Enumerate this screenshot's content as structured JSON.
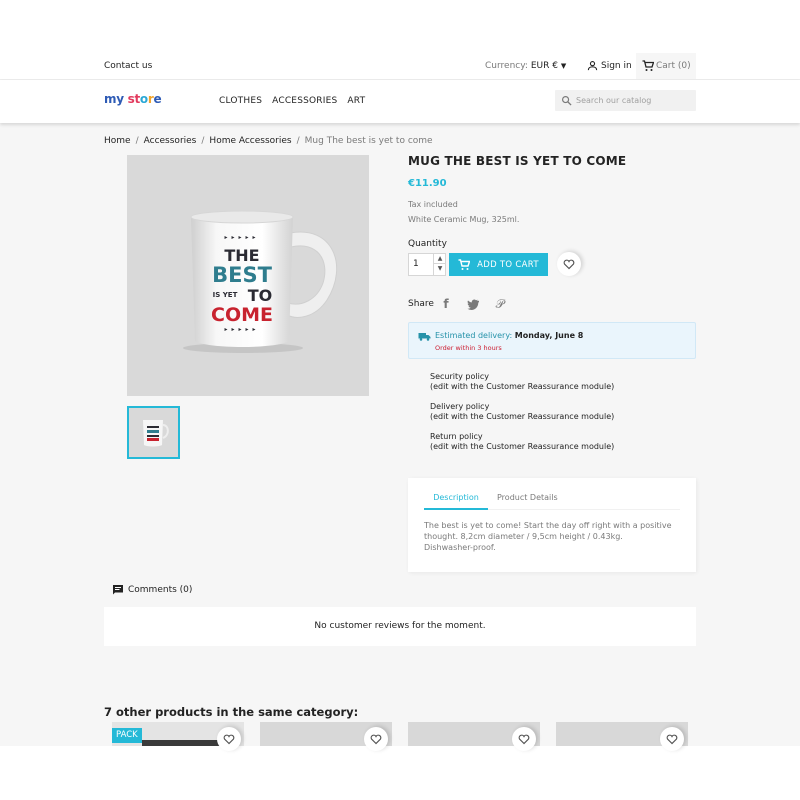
{
  "topbar": {
    "contact": "Contact us",
    "currency_label": "Currency:",
    "currency_value": "EUR €",
    "signin": "Sign in",
    "cart": "Cart (0)"
  },
  "header": {
    "logo": "my store",
    "nav": [
      "CLOTHES",
      "ACCESSORIES",
      "ART"
    ],
    "search_placeholder": "Search our catalog"
  },
  "breadcrumb": [
    "Home",
    "Accessories",
    "Home Accessories",
    "Mug The best is yet to come"
  ],
  "product": {
    "title": "MUG THE BEST IS YET TO COME",
    "price": "€11.90",
    "tax": "Tax included",
    "short_desc": "White Ceramic Mug, 325ml.",
    "quantity_label": "Quantity",
    "quantity_value": "1",
    "add_to_cart": "ADD TO CART",
    "share_label": "Share",
    "mug_text": [
      "THE",
      "BEST",
      "IS YET",
      "TO",
      "COME"
    ]
  },
  "delivery": {
    "label": "Estimated delivery:",
    "date": "Monday, June 8",
    "note": "Order within 3 hours"
  },
  "reassurance": [
    {
      "title": "Security policy",
      "sub": "(edit with the Customer Reassurance module)"
    },
    {
      "title": "Delivery policy",
      "sub": "(edit with the Customer Reassurance module)"
    },
    {
      "title": "Return policy",
      "sub": "(edit with the Customer Reassurance module)"
    }
  ],
  "tabs": {
    "items": [
      "Description",
      "Product Details"
    ],
    "description": "The best is yet to come! Start the day off right with a positive thought. 8,2cm diameter / 9,5cm height / 0.43kg. Dishwasher-proof."
  },
  "comments": {
    "title": "Comments (0)",
    "empty": "No customer reviews for the moment."
  },
  "related": {
    "title": "7 other products in the same category:",
    "badge": "PACK"
  },
  "colors": {
    "accent": "#24b9d7",
    "accent_dark": "#2592a9",
    "sale_red": "#cc1d30"
  },
  "icons": {
    "user": "user-icon",
    "cart": "shopping-cart-icon",
    "search": "search-icon",
    "heart": "heart-icon",
    "truck": "truck-icon",
    "comment": "comment-icon"
  }
}
